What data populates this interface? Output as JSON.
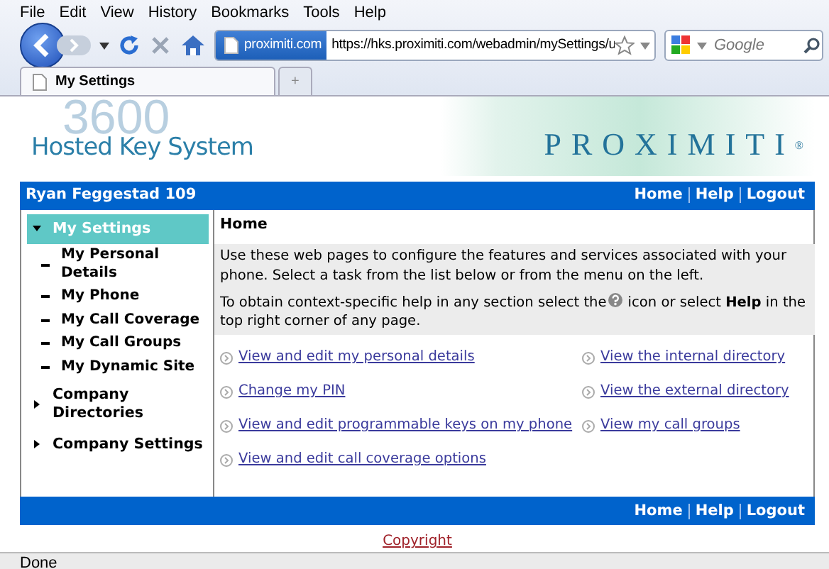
{
  "browser": {
    "menu": [
      "File",
      "Edit",
      "View",
      "History",
      "Bookmarks",
      "Tools",
      "Help"
    ],
    "site_identity": "proximiti.com",
    "url": "https://hks.proximiti.com/webadmin/mySettings/u",
    "search": {
      "placeholder": "Google"
    },
    "tabs": [
      {
        "label": "My Settings",
        "selected": true
      },
      {
        "label": "+",
        "selected": false
      }
    ],
    "status": "Done"
  },
  "header": {
    "watermark": "3600",
    "system_name": "Hosted Key System",
    "brand": "PROXIMITI",
    "brand_mark": "®"
  },
  "top_bar": {
    "user": "Ryan Feggestad 109",
    "links": [
      "Home",
      "Help",
      "Logout"
    ]
  },
  "sidebar": {
    "items": [
      {
        "label": "My Settings",
        "expanded": true,
        "selected": true,
        "children": [
          {
            "label": "My Personal Details"
          },
          {
            "label": "My Phone"
          },
          {
            "label": "My Call Coverage"
          },
          {
            "label": "My Call Groups"
          },
          {
            "label": "My Dynamic Site"
          }
        ]
      },
      {
        "label": "Company Directories",
        "expanded": false,
        "selected": false
      },
      {
        "label": "Company Settings",
        "expanded": false,
        "selected": false
      }
    ]
  },
  "content": {
    "title": "Home",
    "intro": "Use these web pages to configure the features and services associated with your phone. Select a task from the list below or from the menu on the left.",
    "help_before": "To obtain context-specific help in any section select the",
    "help_after_line1": "icon or select **Help** in the",
    "help_after_line2": "top right corner of any page.",
    "links_left": [
      "View and edit my personal details",
      "Change my PIN",
      "View and edit programmable keys on my phone",
      "View and edit call coverage options"
    ],
    "links_right": [
      "View the internal directory",
      "View the external directory",
      "View my call groups"
    ]
  },
  "footer": {
    "links": [
      "Home",
      "Help",
      "Logout"
    ],
    "copyright": "Copyright"
  }
}
